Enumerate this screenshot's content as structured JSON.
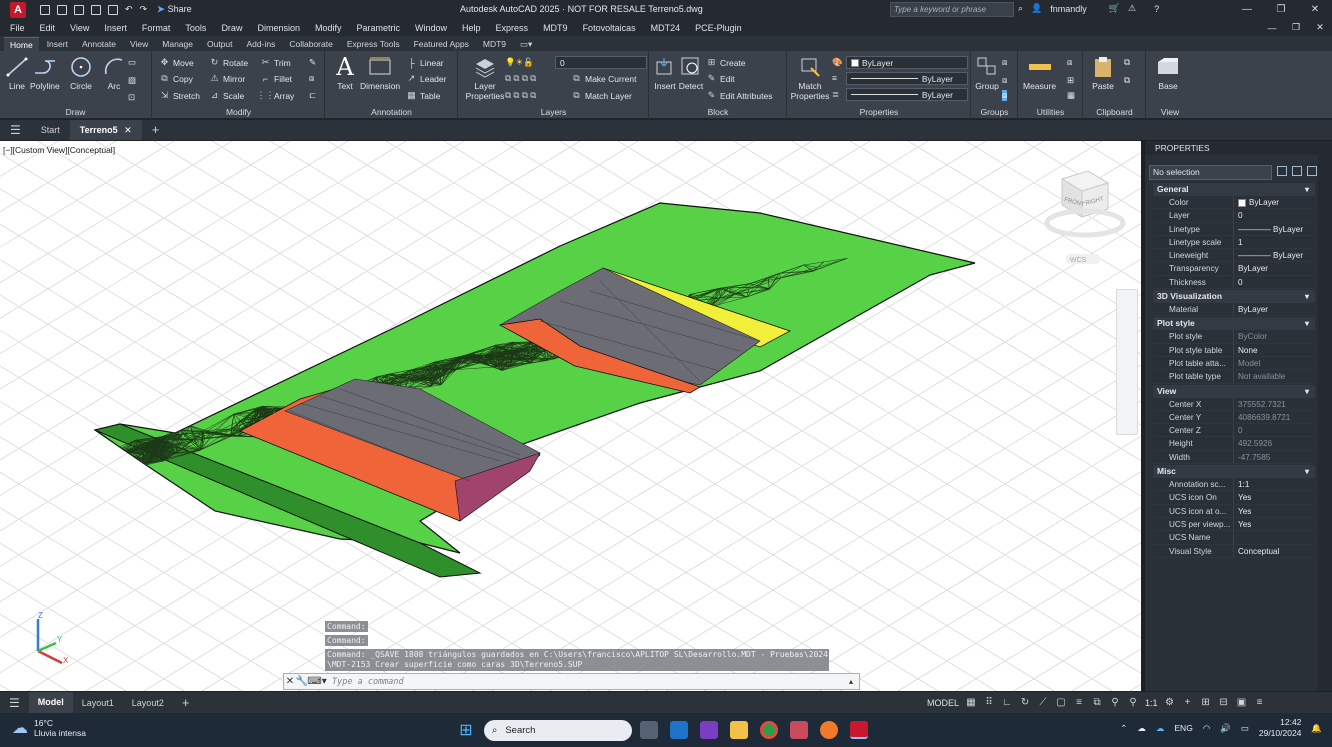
{
  "titlebar": {
    "app_logo": "A",
    "share_label": "Share",
    "window_title": "Autodesk AutoCAD 2025 · NOT FOR RESALE   Terreno5.dwg",
    "search_placeholder": "Type a keyword or phrase",
    "user": "fnmandly"
  },
  "menubar": [
    "File",
    "Edit",
    "View",
    "Insert",
    "Format",
    "Tools",
    "Draw",
    "Dimension",
    "Modify",
    "Parametric",
    "Window",
    "Help",
    "Express",
    "MDT9",
    "Fotovoltaicas",
    "MDT24",
    "PCE-Plugin"
  ],
  "ribbon_tabs": [
    "Home",
    "Insert",
    "Annotate",
    "View",
    "Manage",
    "Output",
    "Add-ins",
    "Collaborate",
    "Express Tools",
    "Featured Apps",
    "MDT9"
  ],
  "ribbon": {
    "draw": {
      "label": "Draw",
      "line": "Line",
      "polyline": "Polyline",
      "circle": "Circle",
      "arc": "Arc"
    },
    "modify": {
      "label": "Modify",
      "move": "Move",
      "rotate": "Rotate",
      "trim": "Trim",
      "copy": "Copy",
      "mirror": "Mirror",
      "fillet": "Fillet",
      "stretch": "Stretch",
      "scale": "Scale",
      "array": "Array"
    },
    "annotation": {
      "label": "Annotation",
      "text": "Text",
      "dimension": "Dimension",
      "linear": "Linear",
      "leader": "Leader",
      "table": "Table"
    },
    "layers": {
      "label": "Layers",
      "layer_properties": "Layer Properties",
      "current_layer": "0",
      "make_current": "Make Current",
      "match_layer": "Match Layer"
    },
    "block": {
      "label": "Block",
      "insert": "Insert",
      "detect": "Detect",
      "create": "Create",
      "edit": "Edit",
      "edit_attributes": "Edit Attributes"
    },
    "properties": {
      "label": "Properties",
      "match_properties": "Match Properties",
      "color": "ByLayer",
      "linetype": "ByLayer",
      "lineweight": "ByLayer"
    },
    "groups": {
      "label": "Groups",
      "group": "Group"
    },
    "utilities": {
      "label": "Utilities",
      "measure": "Measure"
    },
    "clipboard": {
      "label": "Clipboard",
      "paste": "Paste"
    },
    "view": {
      "label": "View",
      "base": "Base"
    }
  },
  "doc_tabs": {
    "start": "Start",
    "active": "Terreno5"
  },
  "viewport": {
    "label": "[−][Custom View][Conceptual]",
    "viewcube_front": "FRONT",
    "viewcube_right": "RIGHT",
    "ucs_label": "WCS",
    "axis_x": "X",
    "axis_y": "Y",
    "axis_z": "Z"
  },
  "command": {
    "line1": "Command:",
    "line2": "Command:",
    "history1": "Command: _QSAVE 1808 triángulos guardados en C:\\Users\\francisco\\APLITOP SL\\Desarrollo.MDT - Pruebas\\2024",
    "history2": "\\MDT-2153 Crear superficie como caras 3D\\Terreno5.SUP",
    "placeholder": "Type a command"
  },
  "properties": {
    "title": "PROPERTIES",
    "selection": "No selection",
    "sections": [
      {
        "name": "General",
        "rows": [
          {
            "k": "Color",
            "v": "ByLayer",
            "swatch": true
          },
          {
            "k": "Layer",
            "v": "0"
          },
          {
            "k": "Linetype",
            "v": "———— ByLayer"
          },
          {
            "k": "Linetype scale",
            "v": "1"
          },
          {
            "k": "Lineweight",
            "v": "———— ByLayer"
          },
          {
            "k": "Transparency",
            "v": "ByLayer"
          },
          {
            "k": "Thickness",
            "v": "0"
          }
        ]
      },
      {
        "name": "3D Visualization",
        "rows": [
          {
            "k": "Material",
            "v": "ByLayer"
          }
        ]
      },
      {
        "name": "Plot style",
        "rows": [
          {
            "k": "Plot style",
            "v": "ByColor",
            "dim": true
          },
          {
            "k": "Plot style table",
            "v": "None"
          },
          {
            "k": "Plot table atta...",
            "v": "Model",
            "dim": true
          },
          {
            "k": "Plot table type",
            "v": "Not available",
            "dim": true
          }
        ]
      },
      {
        "name": "View",
        "rows": [
          {
            "k": "Center X",
            "v": "375552.7321",
            "dim": true
          },
          {
            "k": "Center Y",
            "v": "4086639.8721",
            "dim": true
          },
          {
            "k": "Center Z",
            "v": "0",
            "dim": true
          },
          {
            "k": "Height",
            "v": "492.5926",
            "dim": true
          },
          {
            "k": "Width",
            "v": "-47.7585",
            "dim": true
          }
        ]
      },
      {
        "name": "Misc",
        "rows": [
          {
            "k": "Annotation sc...",
            "v": "1:1"
          },
          {
            "k": "UCS icon On",
            "v": "Yes"
          },
          {
            "k": "UCS icon at o...",
            "v": "Yes"
          },
          {
            "k": "UCS per viewp...",
            "v": "Yes"
          },
          {
            "k": "UCS Name",
            "v": ""
          },
          {
            "k": "Visual Style",
            "v": "Conceptual"
          }
        ]
      }
    ]
  },
  "layout_tabs": [
    "Model",
    "Layout1",
    "Layout2"
  ],
  "status": {
    "model": "MODEL",
    "scale": "1:1"
  },
  "taskbar": {
    "temp": "16°C",
    "weather": "Lluvia intensa",
    "search": "Search",
    "lang": "ENG",
    "time": "12:42",
    "date": "29/10/2024"
  },
  "colors": {
    "terrain": "#57d246",
    "platform": "#6c6c74",
    "slope_orange": "#f0643a",
    "slope_yellow": "#f2ef3a",
    "slope_purple": "#a0446e"
  }
}
